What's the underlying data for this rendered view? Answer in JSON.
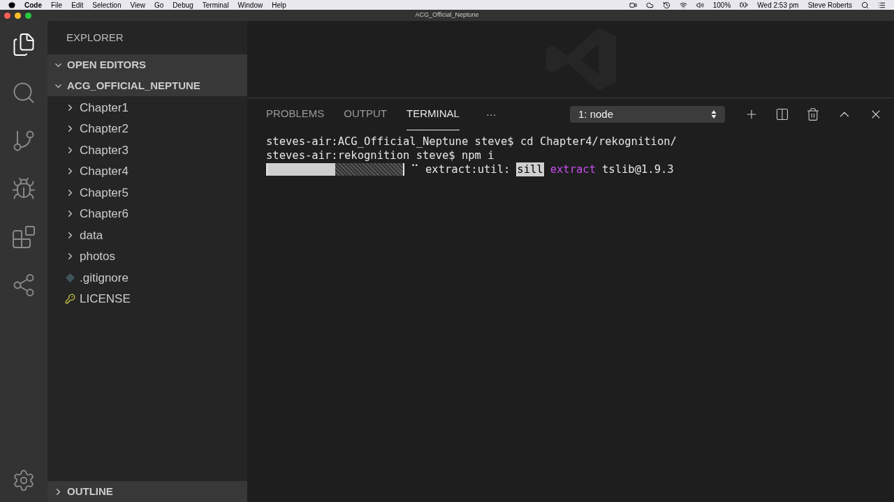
{
  "menubar": {
    "app": "Code",
    "items": [
      "File",
      "Edit",
      "Selection",
      "View",
      "Go",
      "Debug",
      "Terminal",
      "Window",
      "Help"
    ],
    "battery": "100%",
    "clock": "Wed 2:53 pm",
    "user": "Steve Roberts"
  },
  "window": {
    "title": "ACG_Official_Neptune"
  },
  "activity_bar": [
    {
      "kind": "files",
      "selected": true
    },
    {
      "kind": "search",
      "selected": false
    },
    {
      "kind": "git",
      "selected": false
    },
    {
      "kind": "debug",
      "selected": false
    },
    {
      "kind": "extensions",
      "selected": false
    },
    {
      "kind": "share",
      "selected": false
    }
  ],
  "sidebar": {
    "title": "EXPLORER",
    "sections": [
      {
        "label": "OPEN EDITORS",
        "expanded": true
      },
      {
        "label": "ACG_OFFICIAL_NEPTUNE",
        "expanded": true
      }
    ],
    "items": [
      {
        "kind": "folder",
        "label": "Chapter1"
      },
      {
        "kind": "folder",
        "label": "Chapter2"
      },
      {
        "kind": "folder",
        "label": "Chapter3"
      },
      {
        "kind": "folder",
        "label": "Chapter4"
      },
      {
        "kind": "folder",
        "label": "Chapter5"
      },
      {
        "kind": "folder",
        "label": "Chapter6"
      },
      {
        "kind": "folder",
        "label": "data"
      },
      {
        "kind": "folder",
        "label": "photos"
      },
      {
        "kind": "git",
        "label": ".gitignore"
      },
      {
        "kind": "license",
        "label": "LICENSE"
      }
    ],
    "outline": {
      "label": "OUTLINE",
      "expanded": false
    }
  },
  "panel": {
    "tabs": [
      {
        "label": "PROBLEMS",
        "selected": false
      },
      {
        "label": "OUTPUT",
        "selected": false
      },
      {
        "label": "TERMINAL",
        "selected": true
      }
    ],
    "more": "···",
    "terminal_select": "1: node",
    "lines": [
      "steves-air:ACG_Official_Neptune steve$ cd Chapter4/rekognition/",
      "steves-air:rekognition steve$ npm i"
    ],
    "progress": {
      "level": 0.5,
      "spinner": "⠉",
      "stage": "extract:util:",
      "level_tag": "sill",
      "action": "extract",
      "package": "tslib@1.9.3"
    }
  }
}
